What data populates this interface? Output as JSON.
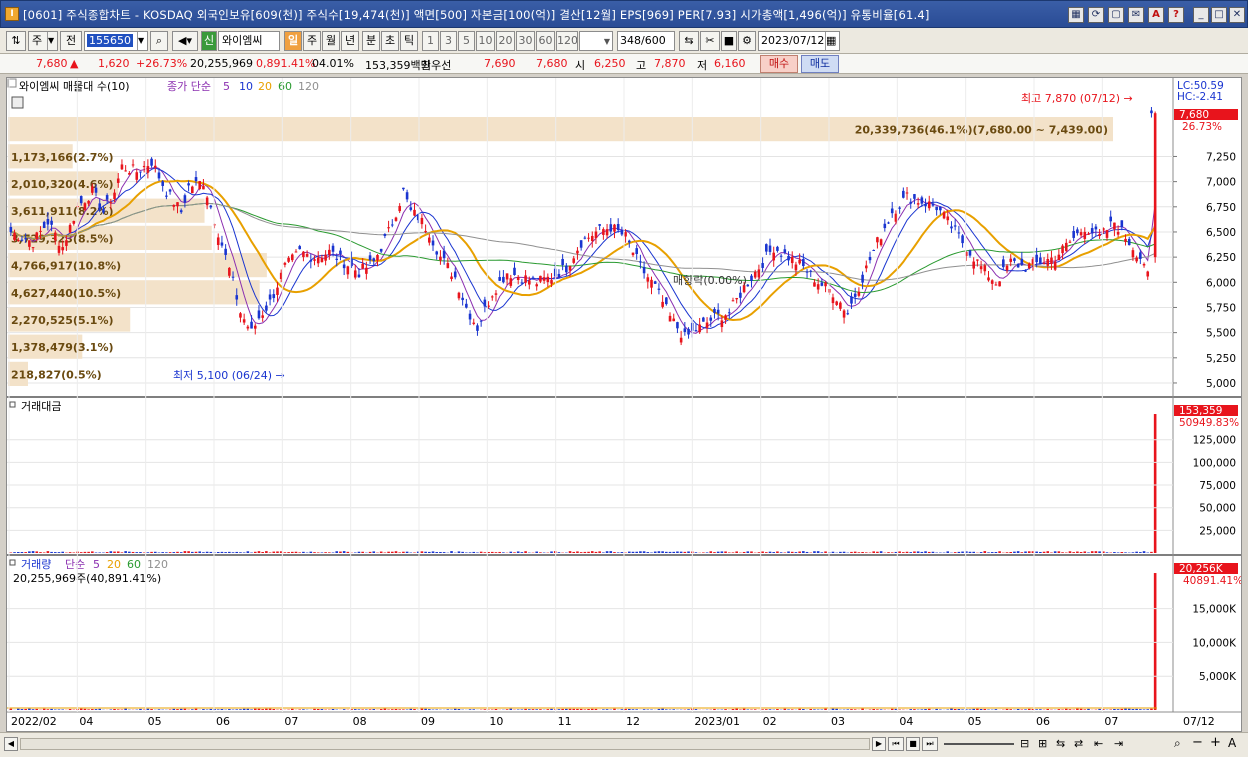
{
  "window": {
    "logo": "I",
    "title": "[0601] 주식종합차트 - KOSDAQ 외국인보유[609(천)] 주식수[19,474(천)] 액면[500] 자본금[100(억)] 결산[12월] EPS[969] PER[7.93] 시가총액[1,496(억)] 유통비율[61.4]",
    "title_buttons": [
      "▦",
      "⟳",
      "▢",
      "✉",
      "A",
      "?"
    ],
    "control_buttons": [
      "_",
      "□",
      "✕"
    ]
  },
  "toolbar": {
    "type_select": "주",
    "prev_label": "전",
    "code_value": "155650",
    "stock_badge": "신",
    "stock_name": "와이엠씨",
    "period_tabs": [
      "일",
      "주",
      "월",
      "년",
      "분",
      "초",
      "틱"
    ],
    "active_period": "일",
    "interval_buttons": [
      "1",
      "3",
      "5",
      "10",
      "20",
      "30",
      "60",
      "120"
    ],
    "count_value": "348",
    "count_total": "/600",
    "date_value": "2023/07/12"
  },
  "quote": {
    "price": "7,680",
    "arrow": "▲",
    "change": "1,620",
    "change_pct": "+26.73%",
    "volume": "20,255,969",
    "vol_ratio": "0,891.41%",
    "turnover_pct": "04.01%",
    "amount": "153,359백만",
    "best_label": "최우선",
    "best_ask": "7,690",
    "best_bid": "7,680",
    "open_label": "시",
    "open": "6,250",
    "high_label": "고",
    "high": "7,870",
    "low_label": "저",
    "low": "6,160",
    "buy_label": "매수",
    "sell_label": "매도"
  },
  "colors": {
    "up": "#e8141c",
    "down": "#1a35d0",
    "ma5": "#8b2fb0",
    "ma10": "#1a35d0",
    "ma20": "#e8a000",
    "ma60": "#2a9a30",
    "ma120": "#909090",
    "vp_bar": "#f3e2c9",
    "vp_text": "#6a4a10"
  },
  "price_panel": {
    "title": "와이엠씨 매물대 수(10)",
    "ma_label": "종가 단순",
    "ma_periods": [
      "5",
      "10",
      "20",
      "60",
      "120"
    ],
    "lc": "LC:50.59",
    "hc": "HC:-2.41",
    "last_price_tag": "7,680",
    "last_pct_tag": "26.73%",
    "high_note": "최고 7,870 (07/12) →",
    "low_note": "최저 5,100 (06/24) →",
    "pattern_note": "매항락(0.00%)",
    "volume_profile": [
      {
        "label": "20,339,736(46.1%)(7,680.00 ~ 7,439.00)",
        "share": 46.1
      },
      {
        "label": "1,173,166(2.7%)",
        "share": 2.7
      },
      {
        "label": "2,010,320(4.6%)",
        "share": 4.6
      },
      {
        "label": "3,611,911(8.2%)",
        "share": 8.2
      },
      {
        "label": "3,729,323(8.5%)",
        "share": 8.5
      },
      {
        "label": "4,766,917(10.8%)",
        "share": 10.8
      },
      {
        "label": "4,627,440(10.5%)",
        "share": 10.5
      },
      {
        "label": "2,270,525(5.1%)",
        "share": 5.1
      },
      {
        "label": "1,378,479(3.1%)",
        "share": 3.1
      },
      {
        "label": "218,827(0.5%)",
        "share": 0.5
      }
    ],
    "y_ticks": [
      "7,250",
      "7,000",
      "6,750",
      "6,500",
      "6,250",
      "6,000",
      "5,750",
      "5,500",
      "5,250",
      "5,000"
    ]
  },
  "amount_panel": {
    "title": "거래대금",
    "last_tag": "153,359",
    "sub_tag": "50949.83%",
    "y_ticks": [
      "125,000",
      "100,000",
      "75,000",
      "50,000",
      "25,000"
    ]
  },
  "volume_panel": {
    "title": "거래량",
    "ma_label": "단순",
    "ma_periods": [
      "5",
      "20",
      "60",
      "120"
    ],
    "info": "20,255,969주(40,891.41%)",
    "last_tag": "20,256K",
    "sub_tag": "40891.41%",
    "y_ticks": [
      "15,000K",
      "10,000K",
      "5,000K"
    ]
  },
  "x_axis": {
    "labels": [
      "2022/02",
      "04",
      "05",
      "06",
      "07",
      "08",
      "09",
      "10",
      "11",
      "12",
      "2023/01",
      "02",
      "03",
      "04",
      "05",
      "06",
      "07"
    ],
    "right_label": "07/12"
  },
  "statusbar": {
    "nav_buttons": [
      "▶",
      "⏮",
      "■",
      "⏭"
    ],
    "tool_buttons": [
      "⊟",
      "⊞",
      "⇆",
      "⇄",
      "⇤",
      "⇥",
      "⌕",
      "−",
      "+",
      "A"
    ]
  },
  "chart_data": {
    "type": "candlestick",
    "title": "와이엠씨 매물대 수(10)",
    "ylim": [
      4950,
      7950
    ],
    "price_keypoints": [
      [
        0,
        6500
      ],
      [
        6,
        6400
      ],
      [
        10,
        6600
      ],
      [
        14,
        6350
      ],
      [
        18,
        6750
      ],
      [
        22,
        6900
      ],
      [
        25,
        6700
      ],
      [
        28,
        6900
      ],
      [
        30,
        7150
      ],
      [
        34,
        7100
      ],
      [
        38,
        7200
      ],
      [
        42,
        6900
      ],
      [
        46,
        6700
      ],
      [
        48,
        6950
      ],
      [
        52,
        7000
      ],
      [
        56,
        6500
      ],
      [
        60,
        6000
      ],
      [
        62,
        5700
      ],
      [
        65,
        5500
      ],
      [
        67,
        5650
      ],
      [
        70,
        5800
      ],
      [
        74,
        6150
      ],
      [
        78,
        6300
      ],
      [
        82,
        6250
      ],
      [
        86,
        6300
      ],
      [
        90,
        6200
      ],
      [
        94,
        6100
      ],
      [
        98,
        6200
      ],
      [
        102,
        6500
      ],
      [
        106,
        6900
      ],
      [
        108,
        6700
      ],
      [
        110,
        6650
      ],
      [
        113,
        6500
      ],
      [
        116,
        6250
      ],
      [
        120,
        6050
      ],
      [
        123,
        5750
      ],
      [
        126,
        5550
      ],
      [
        130,
        5900
      ],
      [
        134,
        6100
      ],
      [
        138,
        6050
      ],
      [
        142,
        6000
      ],
      [
        146,
        6050
      ],
      [
        150,
        6150
      ],
      [
        154,
        6400
      ],
      [
        158,
        6500
      ],
      [
        162,
        6550
      ],
      [
        166,
        6450
      ],
      [
        170,
        6150
      ],
      [
        174,
        5950
      ],
      [
        178,
        5650
      ],
      [
        182,
        5450
      ],
      [
        186,
        5550
      ],
      [
        190,
        5650
      ],
      [
        194,
        5700
      ],
      [
        198,
        5950
      ],
      [
        202,
        6150
      ],
      [
        206,
        6350
      ],
      [
        210,
        6250
      ],
      [
        214,
        6150
      ],
      [
        218,
        6000
      ],
      [
        222,
        5900
      ],
      [
        226,
        5700
      ],
      [
        230,
        6050
      ],
      [
        234,
        6400
      ],
      [
        238,
        6700
      ],
      [
        242,
        6850
      ],
      [
        246,
        6800
      ],
      [
        250,
        6750
      ],
      [
        254,
        6550
      ],
      [
        258,
        6350
      ],
      [
        262,
        6150
      ],
      [
        266,
        6000
      ],
      [
        270,
        6200
      ],
      [
        274,
        6150
      ],
      [
        278,
        6200
      ],
      [
        282,
        6250
      ],
      [
        286,
        6400
      ],
      [
        290,
        6550
      ],
      [
        294,
        6450
      ],
      [
        298,
        6600
      ],
      [
        302,
        6400
      ],
      [
        306,
        6200
      ],
      [
        307,
        6050
      ],
      [
        308,
        7680
      ]
    ],
    "last_close": 7680,
    "amount_ylim": [
      0,
      160000
    ],
    "amount_last": 153359,
    "volume_ylim": [
      0,
      21000
    ],
    "volume_last_k": 20256
  }
}
